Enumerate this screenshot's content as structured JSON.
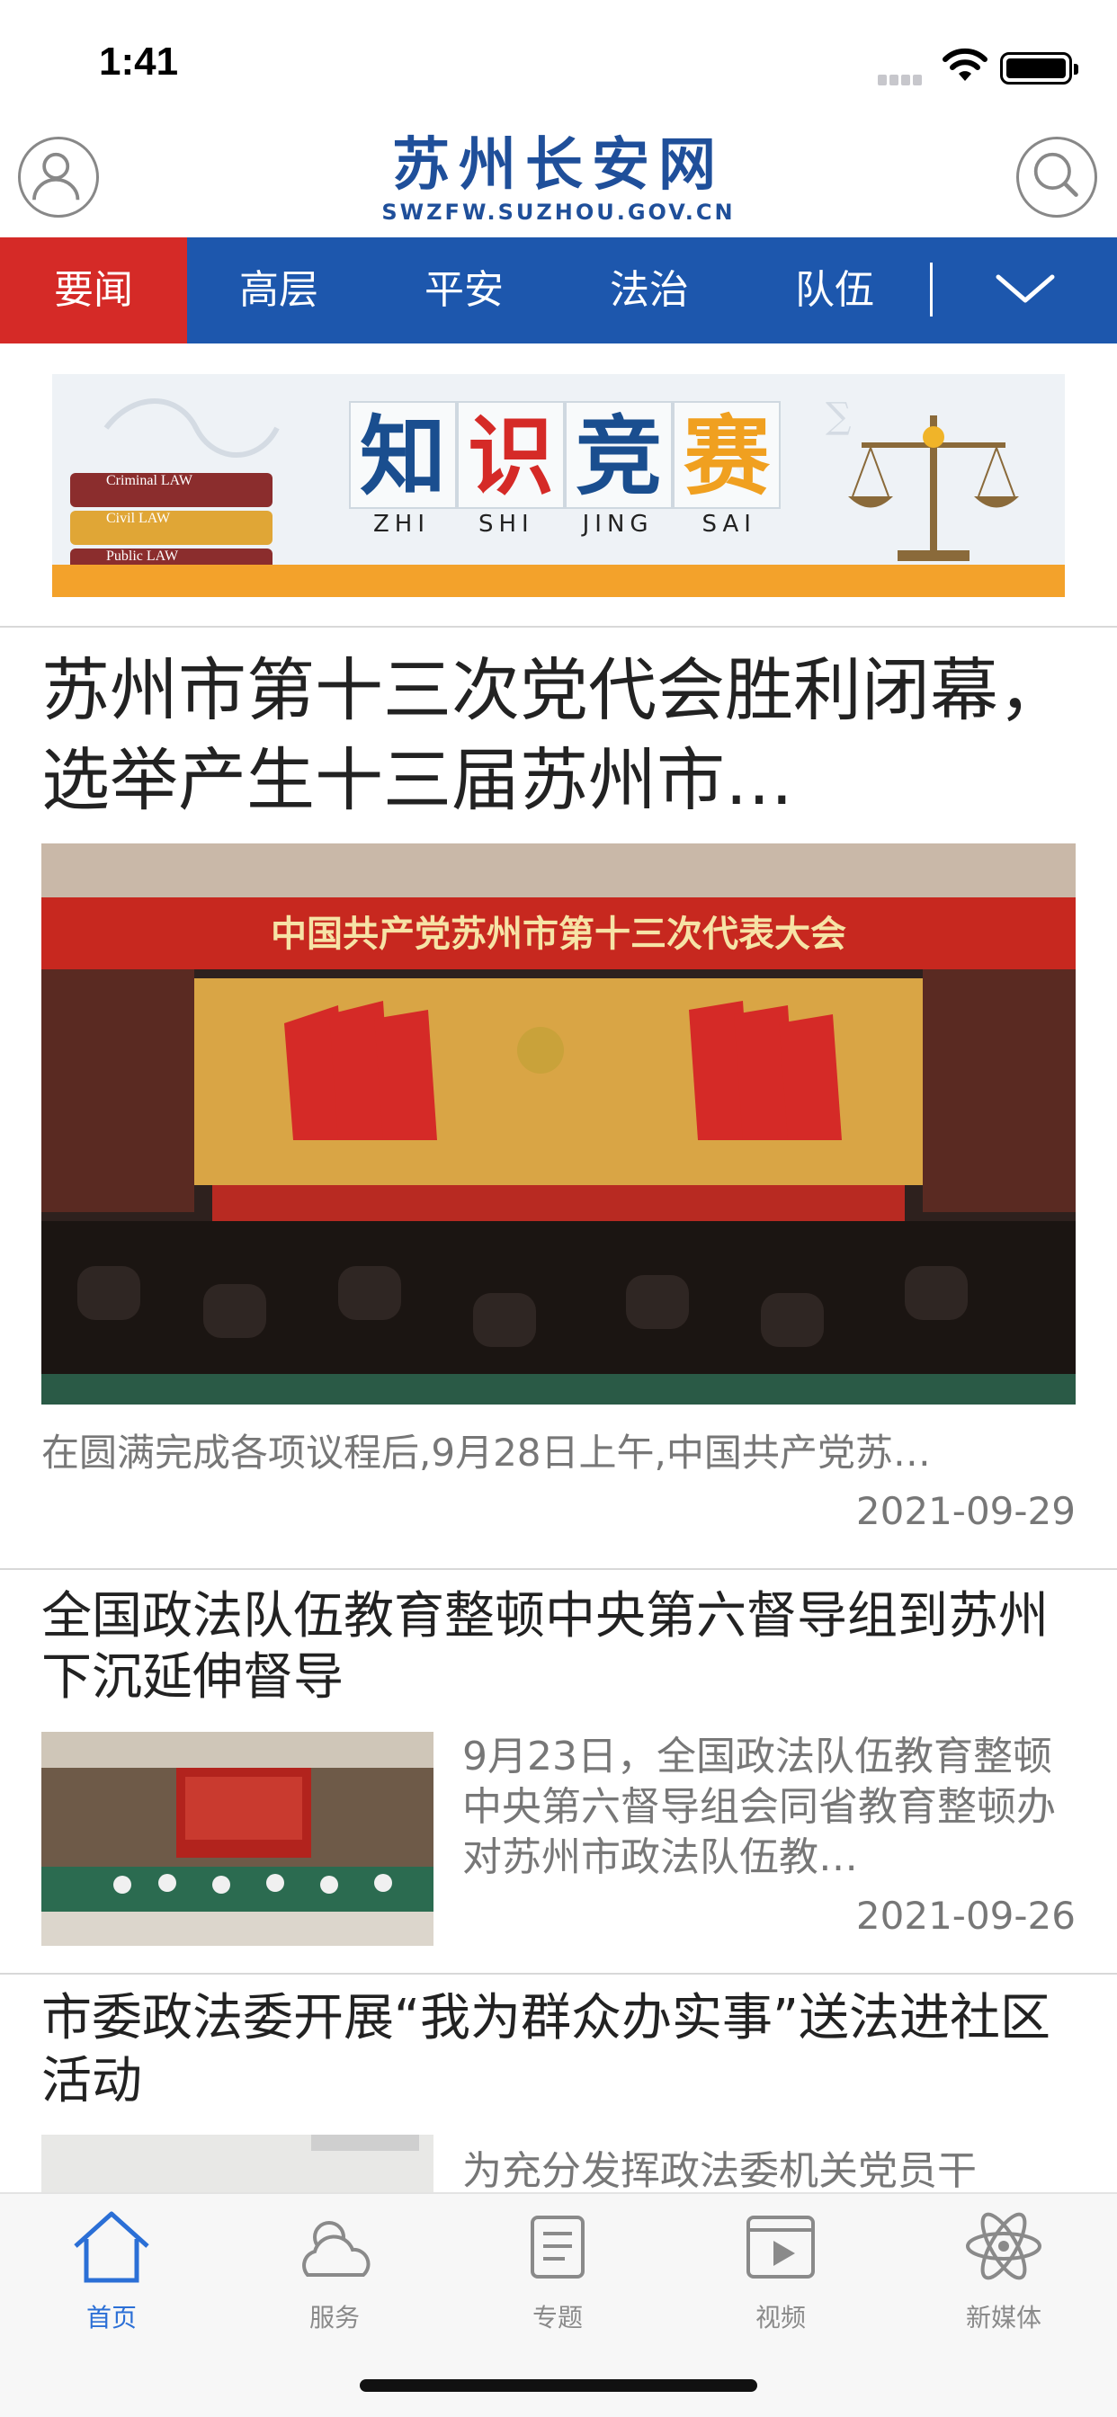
{
  "status_bar": {
    "time": "1:41"
  },
  "header": {
    "logo_main": "苏州长安网",
    "logo_sub": "SWZFW.SUZHOU.GOV.CN",
    "user_icon": "user-icon",
    "search_icon": "search-icon"
  },
  "channels": {
    "tabs": [
      {
        "label": "要闻",
        "active": true
      },
      {
        "label": "高层",
        "active": false
      },
      {
        "label": "平安",
        "active": false
      },
      {
        "label": "法治",
        "active": false
      },
      {
        "label": "队伍",
        "active": false
      }
    ],
    "more_icon": "chevron-down-icon"
  },
  "banner": {
    "chars": [
      "知",
      "识",
      "竞",
      "赛"
    ],
    "pinyin": [
      "ZHI",
      "SHI",
      "JING",
      "SAI"
    ],
    "books": [
      "Criminal LAW",
      "Civil LAW",
      "Public LAW"
    ]
  },
  "articles": [
    {
      "title": "苏州市第十三次党代会胜利闭幕，选举产生十三届苏州市…",
      "photo_banner": "中国共产党苏州市第十三次代表大会",
      "summary": "在圆满完成各项议程后,9月28日上午,中国共产党苏…",
      "date": "2021-09-29"
    },
    {
      "title": "全国政法队伍教育整顿中央第六督导组到苏州下沉延伸督导",
      "summary": "9月23日，全国政法队伍教育整顿中央第六督导组会同省教育整顿办对苏州市政法队伍教…",
      "date": "2021-09-26"
    },
    {
      "title": "市委政法委开展“我为群众办实事”送法进社区活动",
      "summary": "为充分发挥政法委机关党员干"
    }
  ],
  "tab_bar": {
    "items": [
      {
        "label": "首页",
        "icon": "home-icon",
        "active": true
      },
      {
        "label": "服务",
        "icon": "weather-icon",
        "active": false
      },
      {
        "label": "专题",
        "icon": "scroll-icon",
        "active": false
      },
      {
        "label": "视频",
        "icon": "video-icon",
        "active": false
      },
      {
        "label": "新媒体",
        "icon": "atom-icon",
        "active": false
      }
    ]
  },
  "colors": {
    "brand_blue": "#1d57ad",
    "active_red": "#d52a27",
    "tab_active": "#2b6fd6"
  }
}
